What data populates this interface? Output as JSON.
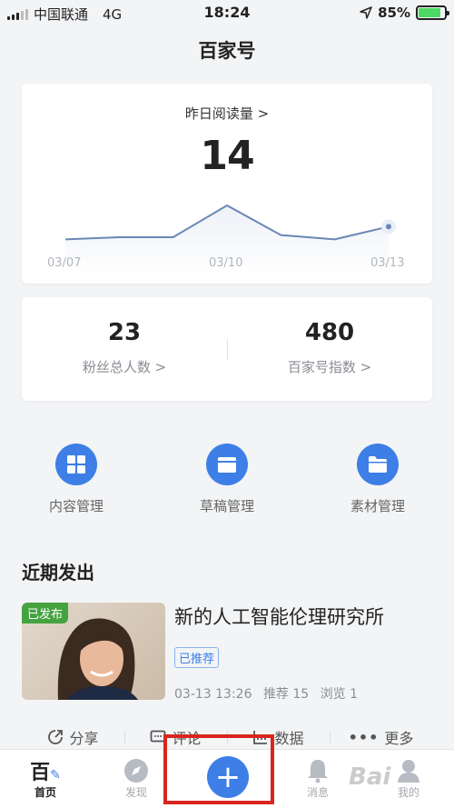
{
  "status_bar": {
    "carrier": "中国联通",
    "network": "4G",
    "time": "18:24",
    "battery_percent": "85%",
    "battery_level": 0.85,
    "battery_color": "#4cd964"
  },
  "nav": {
    "title": "百家号"
  },
  "reads_card": {
    "label": "昨日阅读量 >",
    "value": "14",
    "chart_data": {
      "type": "line",
      "x": [
        "03/07",
        "03/08",
        "03/09",
        "03/10",
        "03/11",
        "03/12",
        "03/13"
      ],
      "series": [
        {
          "values": [
            8,
            9,
            9,
            24,
            10,
            8,
            14
          ]
        }
      ],
      "x_tick_labels": [
        "03/07",
        "03/10",
        "03/13"
      ],
      "ylim": [
        0,
        30
      ],
      "grid": false,
      "line_color": "#6a88b6"
    }
  },
  "stats": [
    {
      "value": "23",
      "label": "粉丝总人数 >"
    },
    {
      "value": "480",
      "label": "百家号指数 >"
    }
  ],
  "tools": [
    {
      "label": "内容管理",
      "icon": "grid-icon"
    },
    {
      "label": "草稿管理",
      "icon": "folder-icon"
    },
    {
      "label": "素材管理",
      "icon": "folder-icon"
    }
  ],
  "recent": {
    "title": "近期发出",
    "post": {
      "status_badge": "已发布",
      "title": "新的人工智能伦理研究所",
      "recommend_badge": "已推荐",
      "date": "03-13 13:26",
      "recommend_count": "推荐 15",
      "views": "浏览 1"
    },
    "actions": [
      {
        "label": "分享",
        "icon": "share-icon"
      },
      {
        "label": "评论",
        "icon": "comment-icon"
      },
      {
        "label": "数据",
        "icon": "data-icon"
      },
      {
        "label": "更多",
        "icon": "more-icon"
      }
    ]
  },
  "tabbar": {
    "items": [
      {
        "label": "首页",
        "icon": "home-icon"
      },
      {
        "label": "发现",
        "icon": "compass-icon"
      },
      {
        "label": "消息",
        "icon": "bell-icon"
      },
      {
        "label": "我的",
        "icon": "user-icon"
      }
    ],
    "fab": "+",
    "accent": "#3d7fe6",
    "highlight_color": "#d8261e"
  },
  "watermark": "Bai"
}
